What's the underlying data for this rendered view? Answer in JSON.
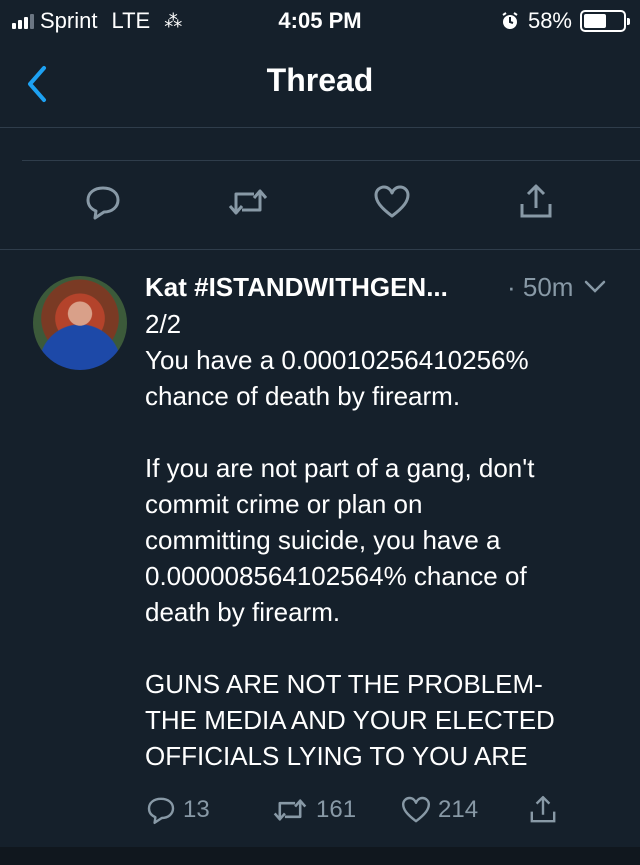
{
  "status_bar": {
    "carrier": "Sprint",
    "network": "LTE",
    "time": "4:05 PM",
    "battery_percent": "58%",
    "battery_level": 0.58,
    "icons": [
      "signal-icon",
      "loading-icon",
      "alarm-icon",
      "battery-icon"
    ]
  },
  "nav": {
    "title": "Thread",
    "back_icon": "chevron-left-icon"
  },
  "previous_tweet_actions": [
    "reply-icon",
    "retweet-icon",
    "like-icon",
    "share-icon"
  ],
  "tweet": {
    "author": "Kat #ISTANDWITHGEN...",
    "time": "· 50m",
    "lines": [
      "2/2",
      "You have a 0.00010256410256%",
      "chance of death by firearm.",
      "",
      "If you are not part of a gang, don't",
      "commit crime or plan on",
      "committing suicide, you have a",
      "0.000008564102564% chance of",
      "death by firearm.",
      "",
      "GUNS ARE NOT THE PROBLEM-",
      "THE MEDIA AND YOUR ELECTED",
      "OFFICIALS LYING TO YOU ARE"
    ],
    "replies": "13",
    "retweets": "161",
    "likes": "214"
  },
  "colors": {
    "background": "#15202b",
    "accent": "#1da1f2",
    "muted": "#8899a6",
    "divider": "#2f3d4b"
  }
}
